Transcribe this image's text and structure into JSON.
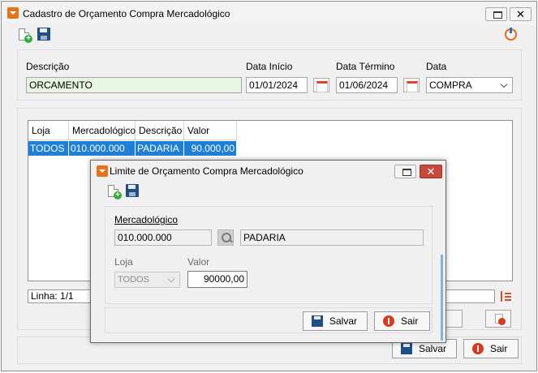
{
  "main": {
    "title": "Cadastro de Orçamento Compra Mercadológico",
    "labels": {
      "descricao": "Descrição",
      "data_inicio": "Data Início",
      "data_termino": "Data Término",
      "data": "Data"
    },
    "values": {
      "descricao": "ORCAMENTO",
      "data_inicio": "01/01/2024",
      "data_termino": "01/06/2024",
      "data": "COMPRA"
    },
    "grid": {
      "columns": [
        "Loja",
        "Mercadológico",
        "Descrição",
        "Valor"
      ],
      "rows": [
        [
          "TODOS",
          "010.000.000",
          "PADARIA",
          "90.000,00"
        ]
      ]
    },
    "status": "Linha: 1/1",
    "buttons": {
      "salvar": "Salvar",
      "sair": "Sair"
    }
  },
  "dialog": {
    "title": "Limite de Orçamento Compra Mercadológico",
    "labels": {
      "mercadologico": "Mercadológico",
      "loja": "Loja",
      "valor": "Valor"
    },
    "values": {
      "mercadologico_code": "010.000.000",
      "mercadologico_desc": "PADARIA",
      "loja": "TODOS",
      "valor": "90000,00"
    },
    "buttons": {
      "salvar": "Salvar",
      "sair": "Sair"
    }
  },
  "colors": {
    "accent": "#e8721c",
    "selection": "#1e7fd6",
    "close_red": "#c9483c",
    "field_green": "#e8f5e2"
  },
  "icons": [
    "app-icon",
    "new-document-icon",
    "save-icon",
    "power-icon",
    "calendar-icon",
    "chevron-down-icon",
    "sort-icon",
    "search-icon",
    "exit-icon",
    "restore-icon",
    "close-icon"
  ]
}
